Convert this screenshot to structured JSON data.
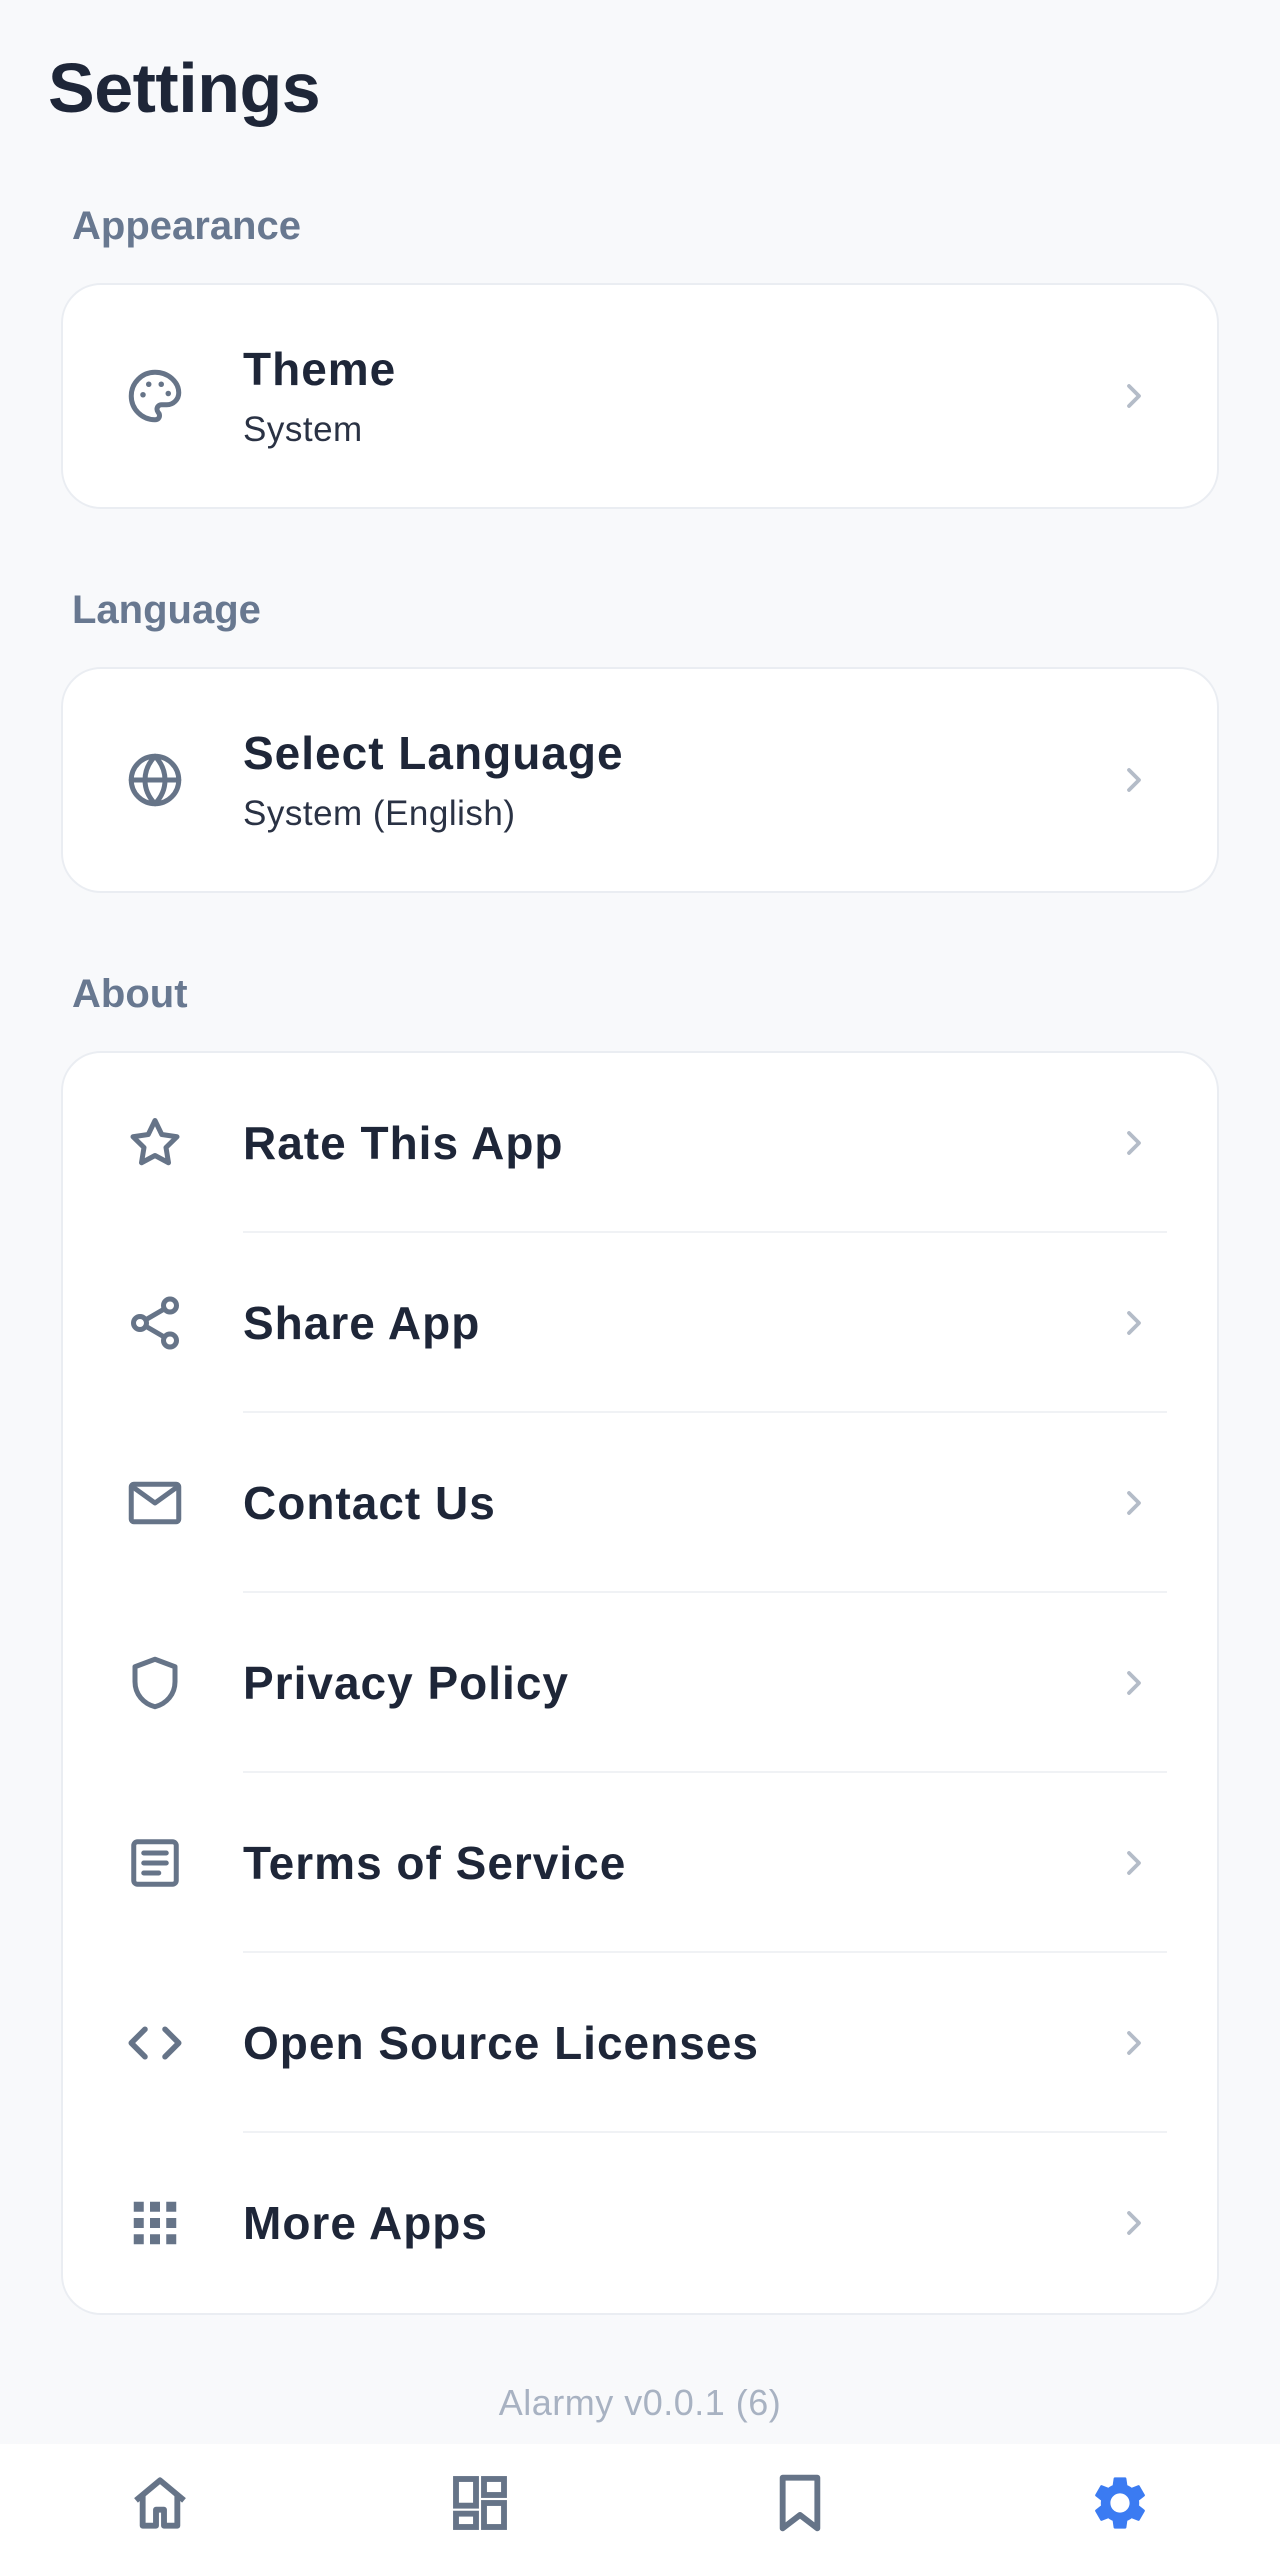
{
  "header": {
    "title": "Settings"
  },
  "sections": {
    "appearance": {
      "label": "Appearance",
      "theme": {
        "label": "Theme",
        "value": "System",
        "icon": "palette-icon"
      }
    },
    "language": {
      "label": "Language",
      "select": {
        "label": "Select Language",
        "value": "System (English)",
        "icon": "globe-icon"
      }
    },
    "about": {
      "label": "About",
      "items": [
        {
          "label": "Rate This App",
          "icon": "star-icon"
        },
        {
          "label": "Share App",
          "icon": "share-icon"
        },
        {
          "label": "Contact Us",
          "icon": "mail-icon"
        },
        {
          "label": "Privacy Policy",
          "icon": "shield-icon"
        },
        {
          "label": "Terms of Service",
          "icon": "document-icon"
        },
        {
          "label": "Open Source Licenses",
          "icon": "code-icon"
        },
        {
          "label": "More Apps",
          "icon": "apps-grid-icon"
        }
      ]
    }
  },
  "footer": {
    "version": "Alarmy v0.0.1 (6)"
  },
  "bottom_nav": {
    "items": [
      {
        "name": "home",
        "icon": "home-icon",
        "active": false
      },
      {
        "name": "dashboard",
        "icon": "dashboard-icon",
        "active": false
      },
      {
        "name": "bookmarks",
        "icon": "bookmark-icon",
        "active": false
      },
      {
        "name": "settings",
        "icon": "gear-icon",
        "active": true
      }
    ]
  },
  "colors": {
    "background": "#f8f9fb",
    "card": "#ffffff",
    "text_primary": "#1e2638",
    "section_label": "#687890",
    "icon": "#667488",
    "chevron": "#b4bcc8",
    "accent": "#3b7bf2"
  }
}
